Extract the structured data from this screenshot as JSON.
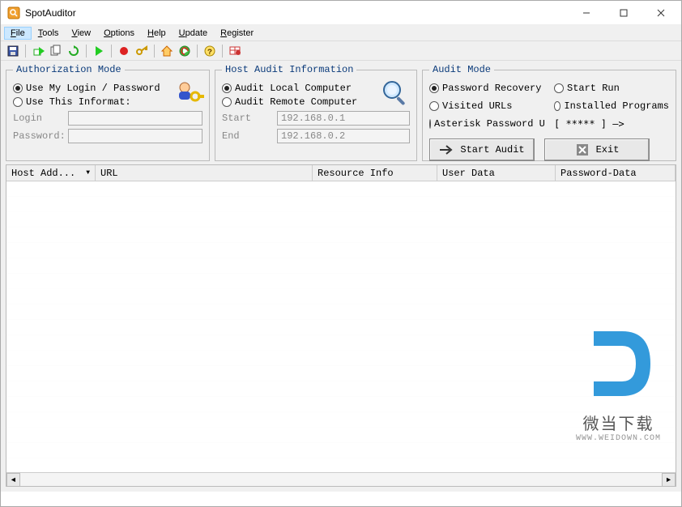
{
  "window": {
    "title": "SpotAuditor"
  },
  "menu": {
    "file": "File",
    "tools": "Tools",
    "view": "View",
    "options": "Options",
    "help": "Help",
    "update": "Update",
    "register": "Register"
  },
  "groups": {
    "auth": {
      "legend": "Authorization Mode",
      "opt1": "Use My Login / Password",
      "opt2": "Use This Informat:",
      "login_label": "Login",
      "login_value": "",
      "password_label": "Password:",
      "password_value": ""
    },
    "hostinfo": {
      "legend": "Host Audit Information",
      "opt1": "Audit Local Computer",
      "opt2": "Audit Remote Computer",
      "start_label": "Start",
      "start_value": "192.168.0.1",
      "end_label": "End",
      "end_value": "192.168.0.2"
    },
    "auditmode": {
      "legend": "Audit Mode",
      "opt1": "Password Recovery",
      "opt2": "Start Run",
      "opt3": "Visited URLs",
      "opt4": "Installed Programs",
      "opt5": "Asterisk Password Uncover",
      "extra": "[ ***** ] —>",
      "start_btn": "Start Audit",
      "exit_btn": "Exit"
    }
  },
  "grid": {
    "columns": [
      "Host Add...",
      "URL",
      "Resource Info",
      "User Data",
      "Password-Data"
    ],
    "rows": []
  },
  "watermark": {
    "cn": "微当下载",
    "url": "WWW.WEIDOWN.COM"
  }
}
